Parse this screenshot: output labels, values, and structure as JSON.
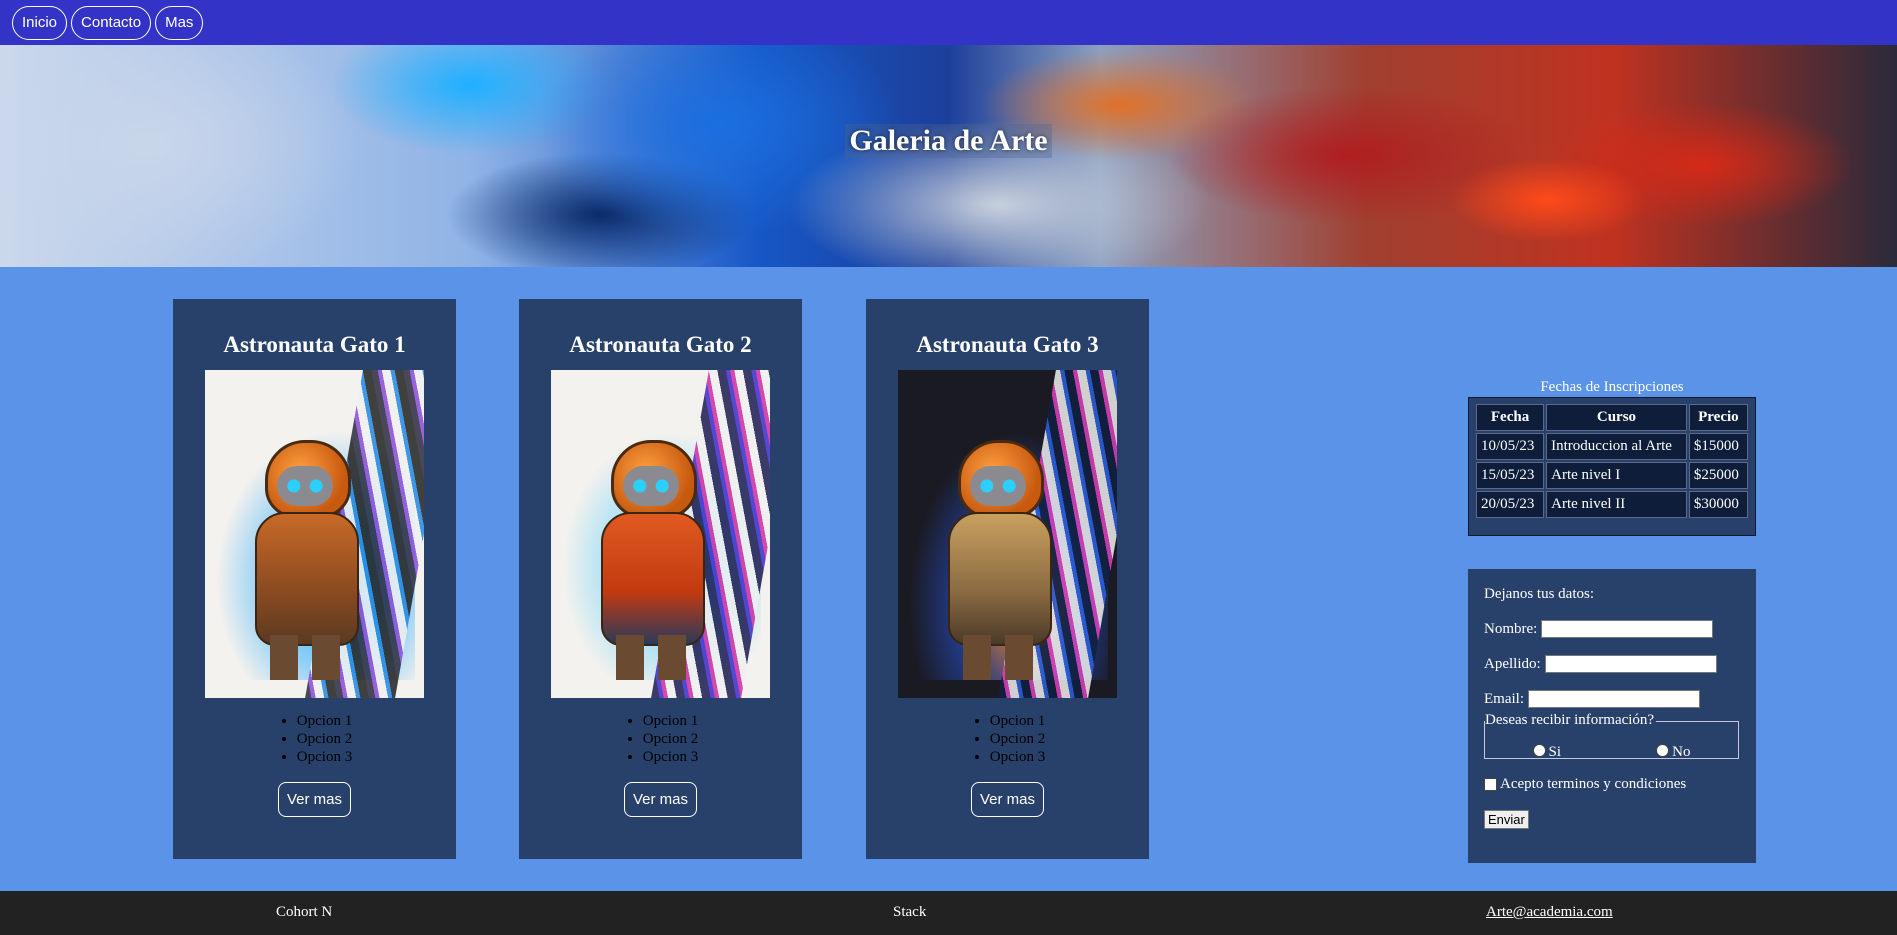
{
  "nav": {
    "items": [
      {
        "label": "Inicio"
      },
      {
        "label": "Contacto"
      },
      {
        "label": "Mas"
      }
    ]
  },
  "hero": {
    "title": "Galeria de Arte"
  },
  "cards": [
    {
      "title": "Astronauta Gato 1",
      "options": [
        "Opcion 1",
        "Opcion 2",
        "Opcion 3"
      ],
      "button": "Ver mas"
    },
    {
      "title": "Astronauta Gato 2",
      "options": [
        "Opcion 1",
        "Opcion 2",
        "Opcion 3"
      ],
      "button": "Ver mas"
    },
    {
      "title": "Astronauta Gato 3",
      "options": [
        "Opcion 1",
        "Opcion 2",
        "Opcion 3"
      ],
      "button": "Ver mas"
    }
  ],
  "table": {
    "caption": "Fechas de Inscripciones",
    "headers": [
      "Fecha",
      "Curso",
      "Precio"
    ],
    "rows": [
      [
        "10/05/23",
        "Introduccion al Arte",
        "$15000"
      ],
      [
        "15/05/23",
        "Arte nivel I",
        "$25000"
      ],
      [
        "20/05/23",
        "Arte nivel II",
        "$30000"
      ]
    ]
  },
  "form": {
    "heading": "Dejanos tus datos:",
    "nombre_label": "Nombre:",
    "apellido_label": "Apellido:",
    "email_label": "Email:",
    "legend": "Deseas recibir información?",
    "radio_si": "Si",
    "radio_no": "No",
    "terms": "Acepto terminos y condiciones",
    "submit": "Enviar"
  },
  "footer": {
    "left": "Cohort N",
    "center": "Stack",
    "email": "Arte@academia.com"
  },
  "colors": {
    "nav_bg": "#3333c8",
    "page_bg": "#5b93e8",
    "panel_bg": "#27416a",
    "footer_bg": "#222222"
  }
}
